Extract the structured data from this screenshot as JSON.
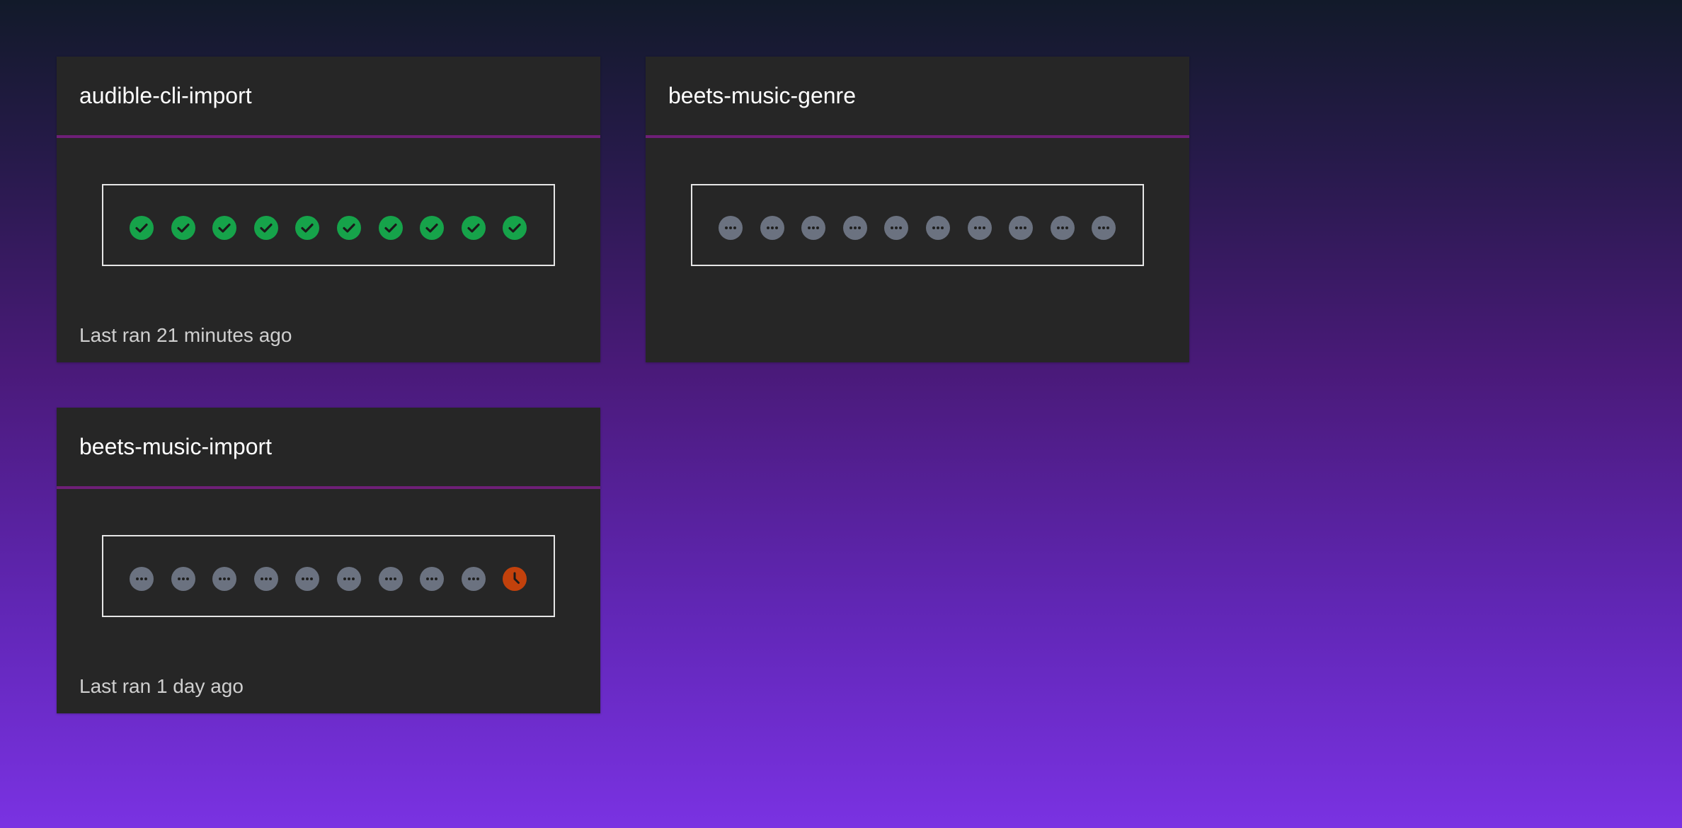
{
  "colors": {
    "card_background": "#262626",
    "header_divider": "#6e1f77",
    "success": "#16a34a",
    "pending": "#6b7280",
    "running": "#c2410c"
  },
  "jobs": [
    {
      "name": "audible-cli-import",
      "runs": [
        "success",
        "success",
        "success",
        "success",
        "success",
        "success",
        "success",
        "success",
        "success",
        "success"
      ],
      "last_ran": "Last ran 21 minutes ago"
    },
    {
      "name": "beets-music-genre",
      "runs": [
        "pending",
        "pending",
        "pending",
        "pending",
        "pending",
        "pending",
        "pending",
        "pending",
        "pending",
        "pending"
      ],
      "last_ran": ""
    },
    {
      "name": "beets-music-import",
      "runs": [
        "pending",
        "pending",
        "pending",
        "pending",
        "pending",
        "pending",
        "pending",
        "pending",
        "pending",
        "running"
      ],
      "last_ran": "Last ran 1 day ago"
    }
  ]
}
